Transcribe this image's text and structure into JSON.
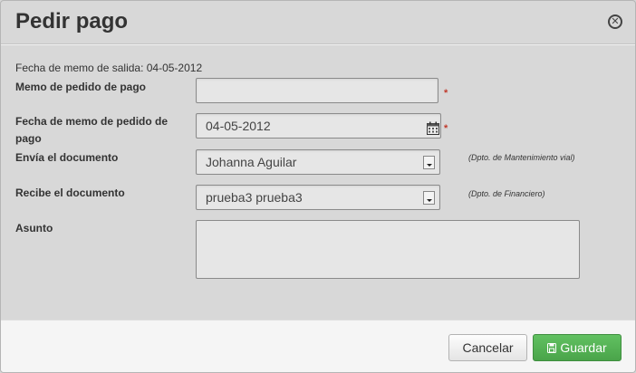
{
  "dialog": {
    "title": "Pedir pago",
    "close_icon": "circle-x-icon"
  },
  "form": {
    "info_text": "Fecha de memo de salida: 04-05-2012",
    "memo_label": "Memo de pedido de pago",
    "memo_value": "",
    "fecha_label": "Fecha de memo de pedido de pago",
    "fecha_value": "04-05-2012",
    "envia_label": "Envía el documento",
    "envia_value": "Johanna Aguilar",
    "envia_dept": "(Dpto. de Mantenimiento vial)",
    "recibe_label": "Recibe el documento",
    "recibe_value": "prueba3 prueba3",
    "recibe_dept": "(Dpto. de Financiero)",
    "asunto_label": "Asunto",
    "asunto_value": "",
    "required_marker": "*"
  },
  "footer": {
    "cancel_label": "Cancelar",
    "save_label": "Guardar"
  },
  "colors": {
    "save_button": "#5cb85c",
    "required": "#c0392b"
  }
}
